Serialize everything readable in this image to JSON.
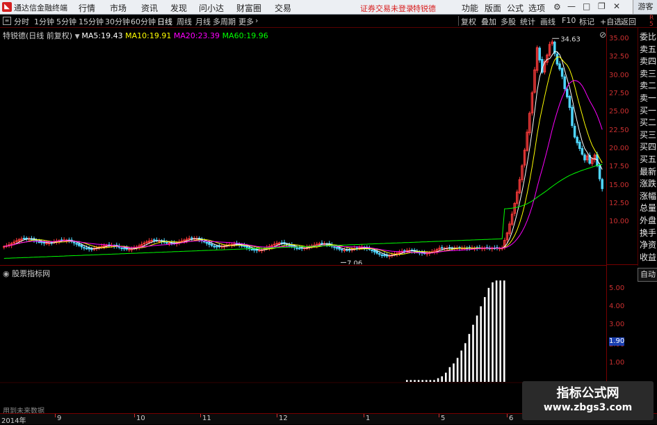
{
  "app_title": "通达信金融终端",
  "menu": [
    "行情",
    "市场",
    "资讯",
    "发现",
    "问小达",
    "财富圈",
    "交易"
  ],
  "warning": "证券交易未登录",
  "stock_name_top": "特锐德",
  "title_right": [
    "功能",
    "版面",
    "公式",
    "选项"
  ],
  "guest": "游客",
  "periods": [
    "分时",
    "1分钟",
    "5分钟",
    "15分钟",
    "30分钟",
    "60分钟",
    "日线",
    "周线",
    "月线",
    "多周期",
    "更多"
  ],
  "toolbar_right": [
    "复权",
    "叠加",
    "多股",
    "统计",
    "画线",
    "F10",
    "标记",
    "+自选",
    "返回"
  ],
  "chart_info": {
    "name": "特锐德(日线 前复权)",
    "ma5_label": "MA5:",
    "ma5": "19.43",
    "ma10_label": "MA10:",
    "ma10": "19.91",
    "ma20_label": "MA20:",
    "ma20": "23.39",
    "ma60_label": "MA60:",
    "ma60": "19.96"
  },
  "price_labels": [
    "35.00",
    "32.50",
    "30.00",
    "27.50",
    "25.00",
    "22.50",
    "20.00",
    "17.50",
    "15.00",
    "12.50",
    "10.00"
  ],
  "annotations": {
    "high": "34.63",
    "low": "7.06"
  },
  "side_panel": [
    "委比",
    "卖五",
    "卖四",
    "卖三",
    "卖二",
    "卖一",
    "买一",
    "买二",
    "买三",
    "买四",
    "买五",
    "最新",
    "涨跌",
    "涨幅",
    "总量",
    "外盘",
    "换手",
    "净资",
    "收益"
  ],
  "axis_top_right": [
    "R",
    "5"
  ],
  "indicator_title": "股票指标网",
  "indicator_labels": [
    "5.00",
    "4.00",
    "3.00",
    "2.00",
    "1.00"
  ],
  "indicator_current": "1.90",
  "auto_button": "自动",
  "future_data": "用到未来数据",
  "x_labels": [
    "2014年",
    "9",
    "10",
    "11",
    "12",
    "1",
    "5",
    "6"
  ],
  "watermark": {
    "title": "指标公式网",
    "url": "www.zbgs3.com"
  },
  "colors": {
    "ma5": "#ffffff",
    "ma10": "#ffff00",
    "ma20": "#ff00ff",
    "ma60": "#00ff00",
    "up": "#ff3b3b",
    "down": "#4fd6ff"
  }
}
